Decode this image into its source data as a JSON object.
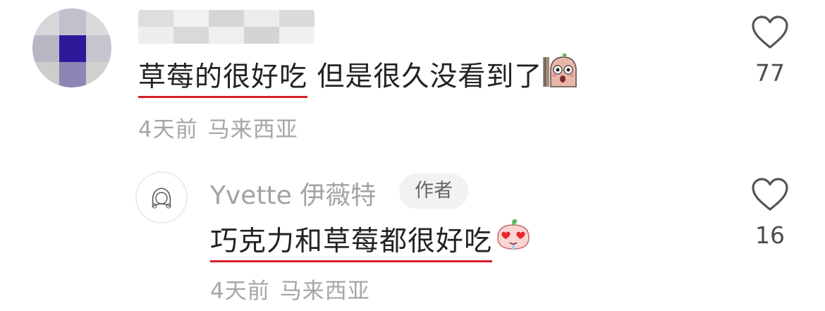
{
  "comment": {
    "text_underlined": "草莓的很好吃",
    "text_rest": " 但是很久没看到了",
    "emoji": "peeking-mushroom-emoji",
    "time": "4天前",
    "location": "马来西亚",
    "likes": "77"
  },
  "reply": {
    "username": "Yvette 伊薇特",
    "author_tag": "作者",
    "text": "巧克力和草莓都很好吃",
    "emoji": "heart-eyes-drooling-emoji",
    "time": "4天前",
    "location": "马来西亚",
    "likes": "16"
  },
  "colors": {
    "underline": "#d6202a",
    "meta": "#a6a6a6",
    "text": "#222222"
  }
}
